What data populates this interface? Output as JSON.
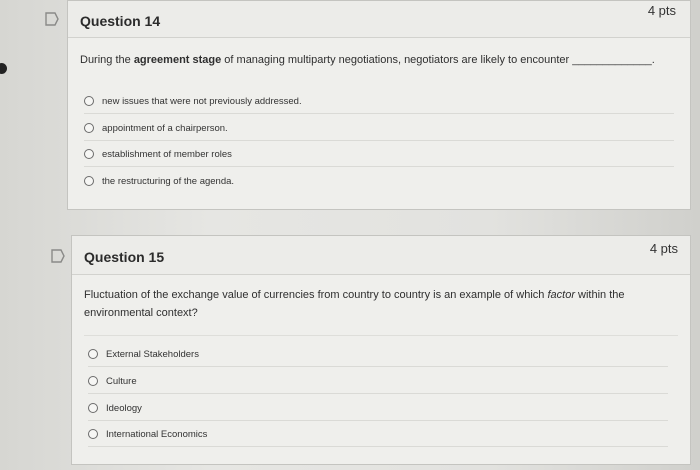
{
  "questions": [
    {
      "title": "Question 14",
      "points": "4 pts",
      "text_parts": [
        "During the ",
        "agreement stage ",
        "of managing multiparty negotiations, negotiators are likely to encounter ",
        "_____________."
      ],
      "answers": [
        "new issues that were not previously addressed.",
        "appointment of a chairperson.",
        "establishment of member roles",
        "the restructuring of the agenda."
      ]
    },
    {
      "title": "Question 15",
      "points": "4 pts",
      "text_parts": [
        "Fluctuation of the exchange value of currencies from country to country is an example of which ",
        "factor",
        " within the environmental context?"
      ],
      "answers": [
        "External Stakeholders",
        "Culture",
        "Ideology",
        "International Economics"
      ]
    }
  ],
  "icons": {
    "flag": "flag-icon",
    "radio": "radio-button-icon"
  },
  "colors": {
    "card_bg": "#efefec",
    "header_bg": "#ecece9",
    "border": "#c4c4c0"
  }
}
